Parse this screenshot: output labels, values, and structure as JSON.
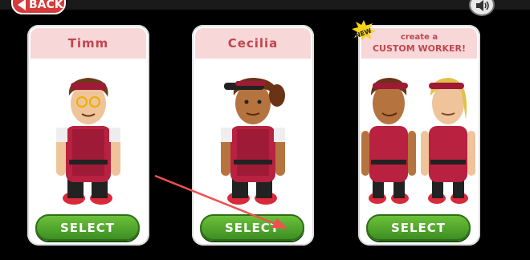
{
  "back_label": "BACK",
  "workers": [
    {
      "name": "Timm",
      "select_label": "SELECT",
      "skin": "#f0c49a",
      "hair": "#6b3a1a"
    },
    {
      "name": "Cecilia",
      "select_label": "SELECT",
      "skin": "#b5743f",
      "hair": "#6a3315"
    },
    {
      "create_label": "create a",
      "custom_label": "CUSTOM WORKER!",
      "badge_label": "NEW",
      "select_label": "SELECT"
    }
  ],
  "colors": {
    "uniform": "#b8213f",
    "visor": "#9e1a37",
    "title_bg": "#f8d7d8",
    "title_text": "#c0464e",
    "select_green": "#4ea82c",
    "annotation_arrow": "#f05050"
  }
}
